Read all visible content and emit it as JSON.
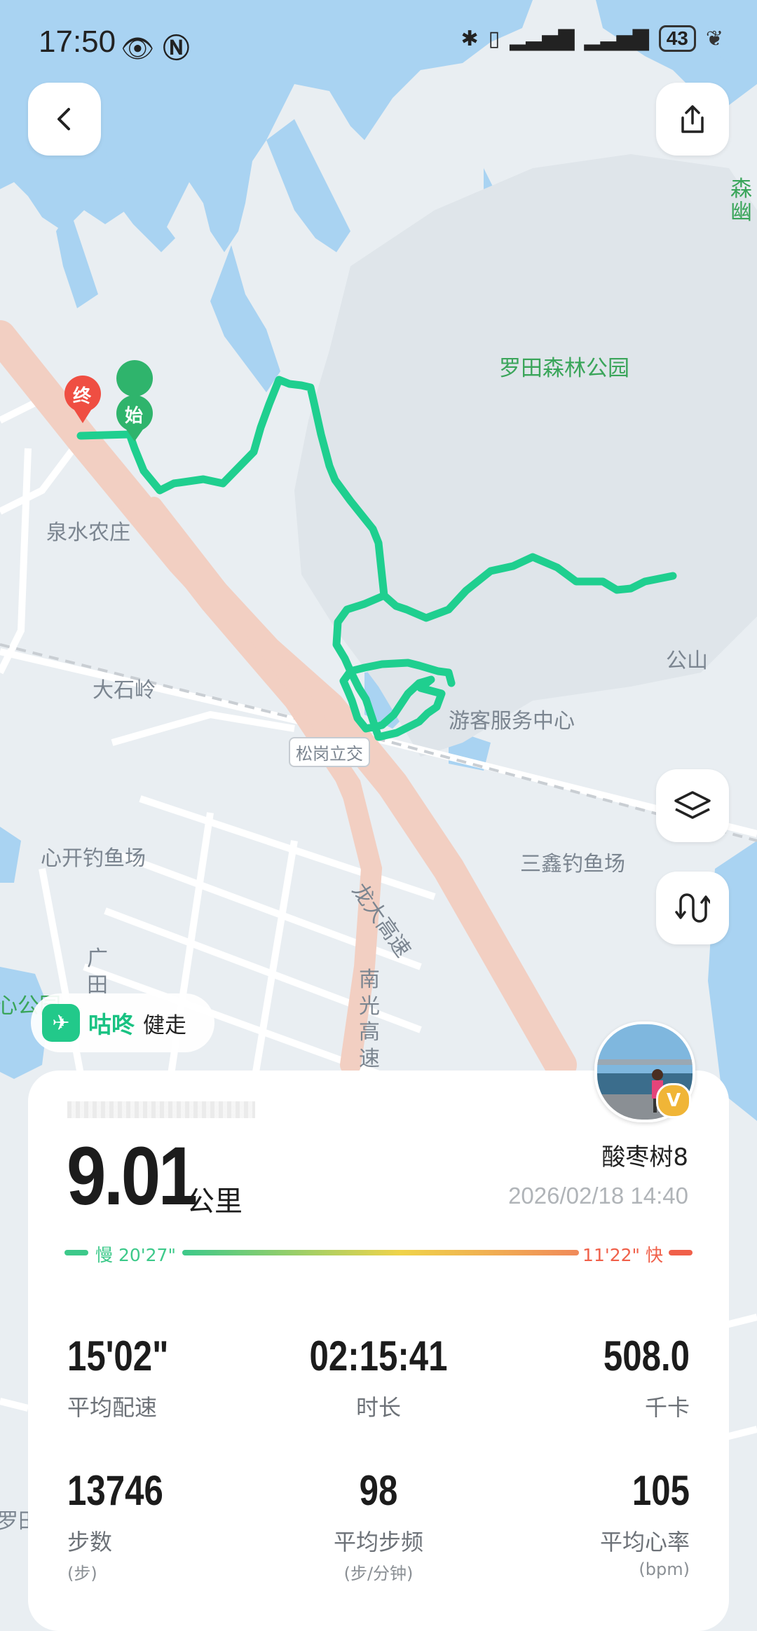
{
  "status_bar": {
    "time": "17:50",
    "battery": "43"
  },
  "map": {
    "labels": {
      "park": "罗田森林公园",
      "park_edge": "森\n幽",
      "quanshui": "泉水农庄",
      "dashiling": "大石岭",
      "visitor_center": "游客服务中心",
      "gongshan": "公山",
      "songgang": "松岗立交",
      "xinkai": "心开钓鱼场",
      "sanxin": "三鑫钓鱼场",
      "longda": "龙大高速",
      "nanguang": "南光高速",
      "guangtian": "广田",
      "park_left": "心公园",
      "luotian_left": "罗田"
    },
    "markers": {
      "start": "始",
      "end": "终"
    }
  },
  "watermark": {
    "brand": "咕咚",
    "mode": "健走"
  },
  "summary": {
    "distance": "9.01",
    "distance_unit": "公里",
    "username": "酸枣树8",
    "datetime": "2026/02/18 14:40",
    "pace_slow": "慢 20'27\"",
    "pace_fast": "11'22\" 快",
    "avatar_badge": "V"
  },
  "stats": [
    {
      "value": "15'02\"",
      "label": "平均配速",
      "sub": ""
    },
    {
      "value": "02:15:41",
      "label": "时长",
      "sub": ""
    },
    {
      "value": "508.0",
      "label": "千卡",
      "sub": ""
    },
    {
      "value": "13746",
      "label": "步数",
      "sub": "(步)"
    },
    {
      "value": "98",
      "label": "平均步频",
      "sub": "(步/分钟)"
    },
    {
      "value": "105",
      "label": "平均心率",
      "sub": "(bpm)"
    }
  ],
  "colors": {
    "route": "#1fcf8f",
    "water": "#a9d3f2",
    "land": "#e9eef2",
    "highway": "#f2cfc2",
    "pace_slow": "#3dc98a",
    "pace_fast": "#f0604a"
  }
}
